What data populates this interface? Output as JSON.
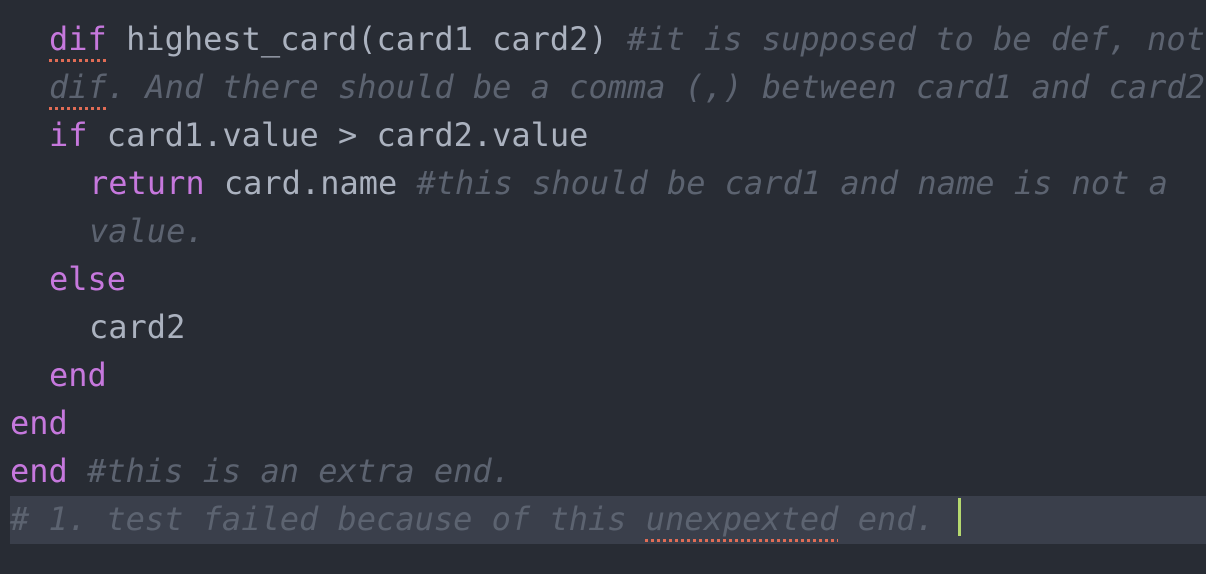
{
  "code": {
    "line1": {
      "kw": "dif",
      "code": " highest_card(card1 card2) ",
      "comment": "#it is supposed to be def, not"
    },
    "line2": {
      "squiggle": "dif",
      "comment": ". And there should be a comma (,) between card1 and card2"
    },
    "line3": {
      "kw": "if",
      "code": " card1.value > card2.value"
    },
    "line4": {
      "kw": "return",
      "code": " card.name ",
      "comment": "#this should be card1 and name is not a"
    },
    "line5": {
      "comment": "value."
    },
    "line6": {
      "kw": "else"
    },
    "line7": {
      "code": "card2"
    },
    "line8": {
      "kw": "end"
    },
    "line9": {
      "kw": "end"
    },
    "line10": {
      "kw": "end",
      "comment": " #this is an extra end."
    },
    "line11": {
      "comment_a": "# 1. test failed because of this ",
      "squiggle": "unexpexted",
      "comment_b": " end. "
    }
  },
  "colors": {
    "background": "#282c34",
    "keyword": "#c678dd",
    "plain": "#abb2bf",
    "comment": "#5c6370",
    "squiggle": "#e06c55",
    "current_line": "#3a3f4b",
    "cursor": "#b5d86f"
  }
}
